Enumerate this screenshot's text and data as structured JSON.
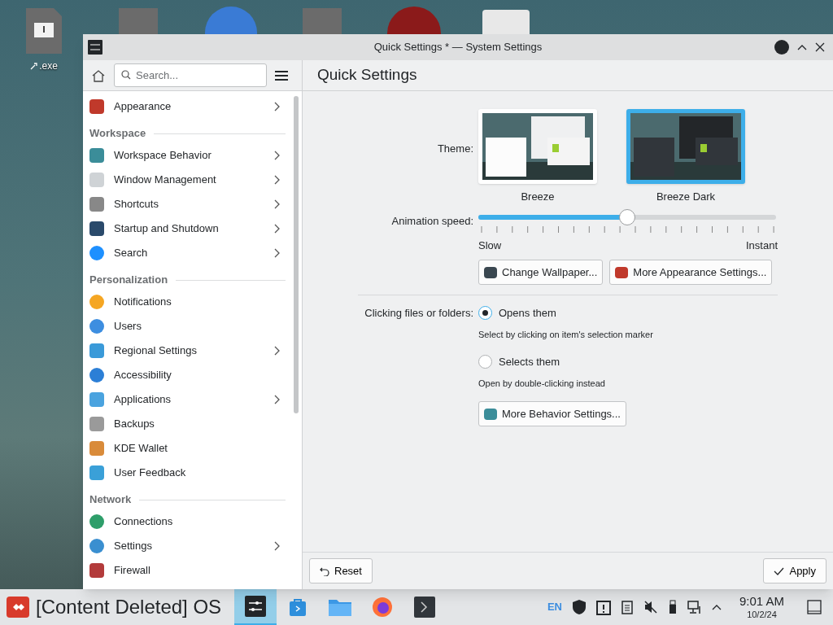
{
  "desktop": {
    "icons": [
      {
        "label": ".exe"
      }
    ]
  },
  "window": {
    "title": "Quick Settings * — System Settings"
  },
  "search": {
    "placeholder": "Search..."
  },
  "page_title": "Quick Settings",
  "sidebar": {
    "sections": [
      {
        "items": [
          {
            "label": "Appearance",
            "has_children": true
          }
        ]
      },
      {
        "heading": "Workspace",
        "items": [
          {
            "label": "Workspace Behavior",
            "has_children": true
          },
          {
            "label": "Window Management",
            "has_children": true
          },
          {
            "label": "Shortcuts",
            "has_children": true
          },
          {
            "label": "Startup and Shutdown",
            "has_children": true
          },
          {
            "label": "Search",
            "has_children": true
          }
        ]
      },
      {
        "heading": "Personalization",
        "items": [
          {
            "label": "Notifications",
            "has_children": false
          },
          {
            "label": "Users",
            "has_children": false
          },
          {
            "label": "Regional Settings",
            "has_children": true
          },
          {
            "label": "Accessibility",
            "has_children": false
          },
          {
            "label": "Applications",
            "has_children": true
          },
          {
            "label": "Backups",
            "has_children": false
          },
          {
            "label": "KDE Wallet",
            "has_children": false
          },
          {
            "label": "User Feedback",
            "has_children": false
          }
        ]
      },
      {
        "heading": "Network",
        "items": [
          {
            "label": "Connections",
            "has_children": false
          },
          {
            "label": "Settings",
            "has_children": true
          },
          {
            "label": "Firewall",
            "has_children": false
          }
        ]
      }
    ]
  },
  "theme": {
    "label": "Theme:",
    "options": [
      {
        "name": "Breeze",
        "kind": "light",
        "selected": false
      },
      {
        "name": "Breeze Dark",
        "kind": "dark",
        "selected": true
      }
    ]
  },
  "animation": {
    "label": "Animation speed:",
    "level": 0.5,
    "min_label": "Slow",
    "max_label": "Instant"
  },
  "appearance_buttons": [
    "Change Wallpaper...",
    "More Appearance Settings..."
  ],
  "clicking": {
    "label": "Clicking files or folders:",
    "options": [
      {
        "label": "Opens them",
        "hint": "Select by clicking on item's selection marker",
        "selected": true
      },
      {
        "label": "Selects them",
        "hint": "Open by double-clicking instead",
        "selected": false
      }
    ]
  },
  "behavior_button": "More Behavior Settings...",
  "footer": {
    "reset": "Reset",
    "apply": "Apply"
  },
  "taskbar": {
    "start_label": "[Content Deleted] OS",
    "tasks": [
      {
        "kind": "settings",
        "selected": true
      },
      {
        "kind": "store",
        "selected": false
      },
      {
        "kind": "files",
        "selected": false
      },
      {
        "kind": "browser",
        "selected": false
      },
      {
        "kind": "terminal",
        "selected": false
      }
    ],
    "language": "EN",
    "time": "9:01 AM",
    "date": "10/2/24"
  }
}
